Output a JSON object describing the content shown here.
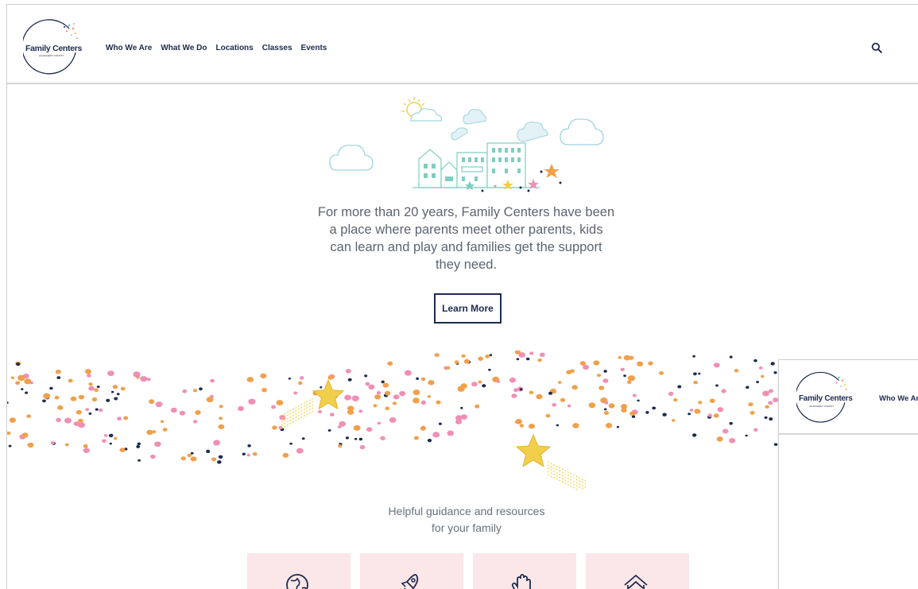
{
  "brand": {
    "name": "Family Centers",
    "subtitle": "ALLEGHENY COUNTY"
  },
  "nav": {
    "items": [
      {
        "label": "Who We Are"
      },
      {
        "label": "What We Do"
      },
      {
        "label": "Locations"
      },
      {
        "label": "Classes"
      },
      {
        "label": "Events"
      }
    ],
    "search_icon": "search-icon"
  },
  "hero": {
    "intro": "For more than 20 years, Family Centers have been a place where parents meet other parents, kids can learn and play and families get the support they need.",
    "cta_label": "Learn More"
  },
  "resources": {
    "heading": "Helpful guidance and resources for your family",
    "cards": [
      {
        "icon": "globe-icon"
      },
      {
        "icon": "rocket-icon"
      },
      {
        "icon": "hand-icon"
      },
      {
        "icon": "house-icon"
      }
    ]
  },
  "overlay": {
    "brand_name": "Family Centers",
    "brand_subtitle": "ALLEGHENY COUNTY",
    "nav_first": "Who We Ar"
  },
  "colors": {
    "navy": "#1d2b4f",
    "orange": "#f0a04b",
    "pink": "#f08fb5",
    "mint": "#7fcfc0",
    "star_yellow": "#f2cf4a",
    "card_bg": "#fbe7e7"
  }
}
